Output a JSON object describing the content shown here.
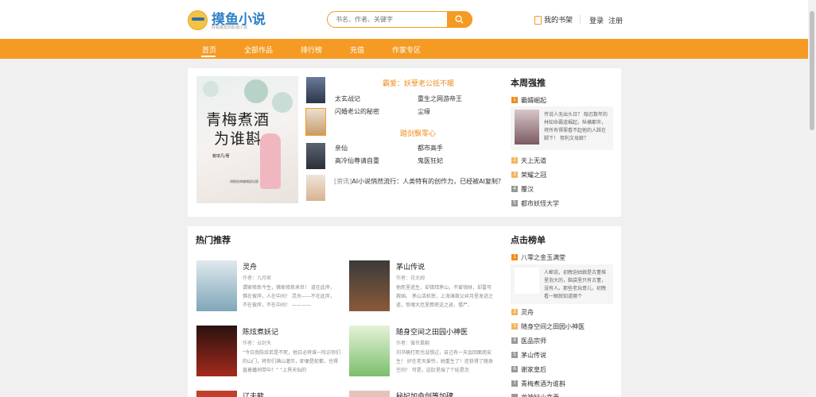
{
  "header": {
    "logo_text": "摸鱼小说",
    "logo_sub": "好看最爱的影视小说",
    "search_placeholder": "书名、作者、关键字",
    "shelf_label": "我的书架",
    "login_label": "登录",
    "register_label": "注册"
  },
  "nav": {
    "items": [
      "首页",
      "全部作品",
      "排行榜",
      "充值",
      "作家专区"
    ],
    "active": "首页"
  },
  "featured": {
    "cover_title_line1": "青梅煮酒",
    "cover_title_line2": "为谁斟",
    "cover_author": "戴琪凡/著",
    "cover_publisher": "胡桃经典编辑部出版",
    "group1_title": "霸爱：妖孽老公抵不暖",
    "group1_items": [
      "太玄战记",
      "重生之网游帝王",
      "闪婚老公的秘密",
      "尘缘"
    ],
    "group2_title": "踏剑飘零心",
    "group2_items": [
      "亲仙",
      "都市高手",
      "高冷仙尊请自重",
      "鬼医狂妃"
    ],
    "news": {
      "tag": "[资讯]",
      "text": "AI小说悄然流行：人类特有的创作力，已经被AI复制？"
    }
  },
  "weekly": {
    "title": "本周强推",
    "top_item": {
      "name": "霸婿崛起",
      "desc": "传说人无出头日？ 隐忍数年的林知命霸道崛起，纵横都市，将所有得罪看不起他的人踩在脚下！ 努利文母娘？"
    },
    "items": [
      "天上无道",
      "荣耀之冠",
      "覆汉",
      "都市妖怪大学"
    ]
  },
  "hot": {
    "title": "热门推荐",
    "books": [
      {
        "title": "灵舟",
        "author": "作者：九月家",
        "desc": "谓家修炼今生，佛家修炼来世！ 道在此岸，佛在彼岸，人在中间！ 灵舟——不在此岸，不在彼岸，不在中间！ ————"
      },
      {
        "title": "茅山传说",
        "author": "作者：花太姆",
        "desc": "他死里逃生，却错拜茅山，不爱钱财，却雷可救国。 茅山活机密，上海滩救父丝月里发迹之道，惊魂大厄里葬密这之途，僵尸、"
      },
      {
        "title": "陈炫煮妖记",
        "author": "作者：云封天",
        "desc": "“今日我陈炫若是不死，他日必将谁一阵访你们的山门，将你们满山灌尽，即便是蛇都，也得直着蟠伺带中！” “上界天仙的"
      },
      {
        "title": "随身空间之田园小神医",
        "author": "作者：循世囊翻",
        "desc": "刘书楠打死也没想过，自己有一天会回面南安生！ 好在老天爱怜，她重生了！还获得了随身空间！ 可是，这肚里揣了个娃是怎"
      },
      {
        "title": "辽夫龍",
        "author": "",
        "desc": ""
      },
      {
        "title": "秘妃加命创等加碑",
        "author": "",
        "desc": ""
      }
    ]
  },
  "click_rank": {
    "title": "点击榜单",
    "top_item": {
      "name": "八零之金玉满堂",
      "desc": "人郵说，初晚迫姑娘是古董堆里泡大的，脑袋里只有古董，没有人。那些老玩意儿，初晚看一眼就知道哪个"
    },
    "items": [
      "灵舟",
      "随身空间之田园小神医",
      "医品宗师",
      "茅山传说",
      "谢家皇后",
      "青梅煮酒为谁斟",
      "龙神妃小幸妻"
    ]
  },
  "colors": {
    "accent": "#f59b23",
    "gold": "#f08c1e",
    "rank_top": "#f08c1e",
    "rank_mid": "#f5b45e",
    "rank_low": "#999999"
  }
}
